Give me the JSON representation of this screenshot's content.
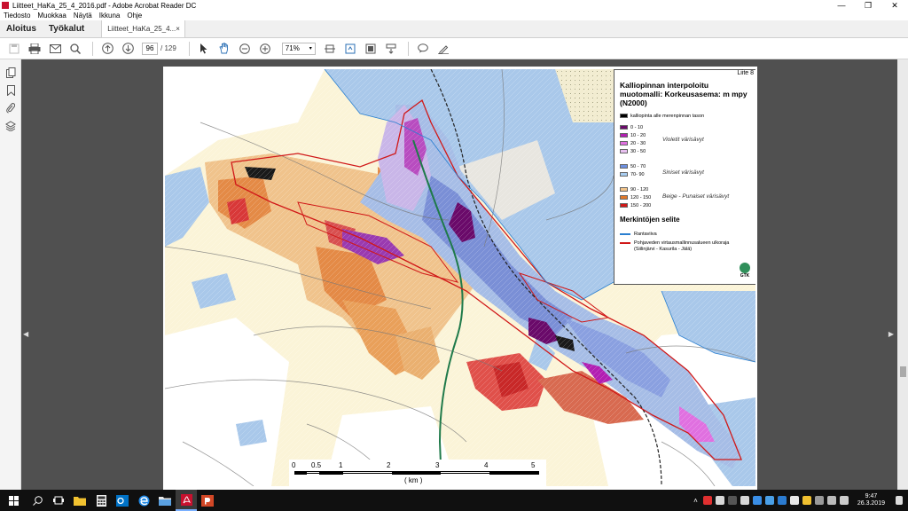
{
  "window": {
    "title": "Liitteet_HaKa_25_4_2016.pdf - Adobe Acrobat Reader DC",
    "minimize": "—",
    "maximize": "❐",
    "close": "✕"
  },
  "menu": [
    "Tiedosto",
    "Muokkaa",
    "Näytä",
    "Ikkuna",
    "Ohje"
  ],
  "tabs": {
    "home": "Aloitus",
    "tools": "Työkalut",
    "document": "Liitteet_HaKa_25_4...",
    "close": "×"
  },
  "toolbar": {
    "page_current": "96",
    "page_total": "/ 129",
    "zoom": "71%"
  },
  "map": {
    "page_label": "Liite 8",
    "legend_title": "Kalliopinnan interpoloitu muotomalli: Korkeusasema: m mpy (N2000)",
    "below_sea": "kalliopinta alle merenpinnan tason",
    "classes": [
      {
        "label": "0 - 10",
        "color": "#6a0a6a"
      },
      {
        "label": "10 - 20",
        "color": "#b21fb2"
      },
      {
        "label": "20 - 30",
        "color": "#e070e0"
      },
      {
        "label": "30 - 50",
        "color": "#e8c0f0"
      },
      {
        "label": "50 - 70",
        "color": "#6c8fe0"
      },
      {
        "label": "70- 90",
        "color": "#a8cdf0"
      },
      {
        "label": "90 - 120",
        "color": "#f2c48a"
      },
      {
        "label": "120 - 150",
        "color": "#e0782a"
      },
      {
        "label": "150 - 200",
        "color": "#d01818"
      }
    ],
    "group_violet": "Violetit värisävyt",
    "group_blue": "Siniset värisävyt",
    "group_beige": "Beige - Punaiset värisävyt",
    "legend_subtitle": "Merkintöjen selite",
    "line_items": [
      {
        "label": "Rantaviiva",
        "color": "#2a7fd0"
      },
      {
        "label": "Pohjaveden virtausmallinnusalueen ulkoraja (Siilinjärvi - Kasurila - Jälä)",
        "color": "#d01818"
      }
    ],
    "logo_text": "GTK",
    "scale_labels": [
      "0",
      "0.5",
      "1",
      "2",
      "3",
      "4",
      "5"
    ],
    "scale_unit": "( km )"
  },
  "taskbar": {
    "time": "9:47",
    "date": "26.3.2019"
  }
}
